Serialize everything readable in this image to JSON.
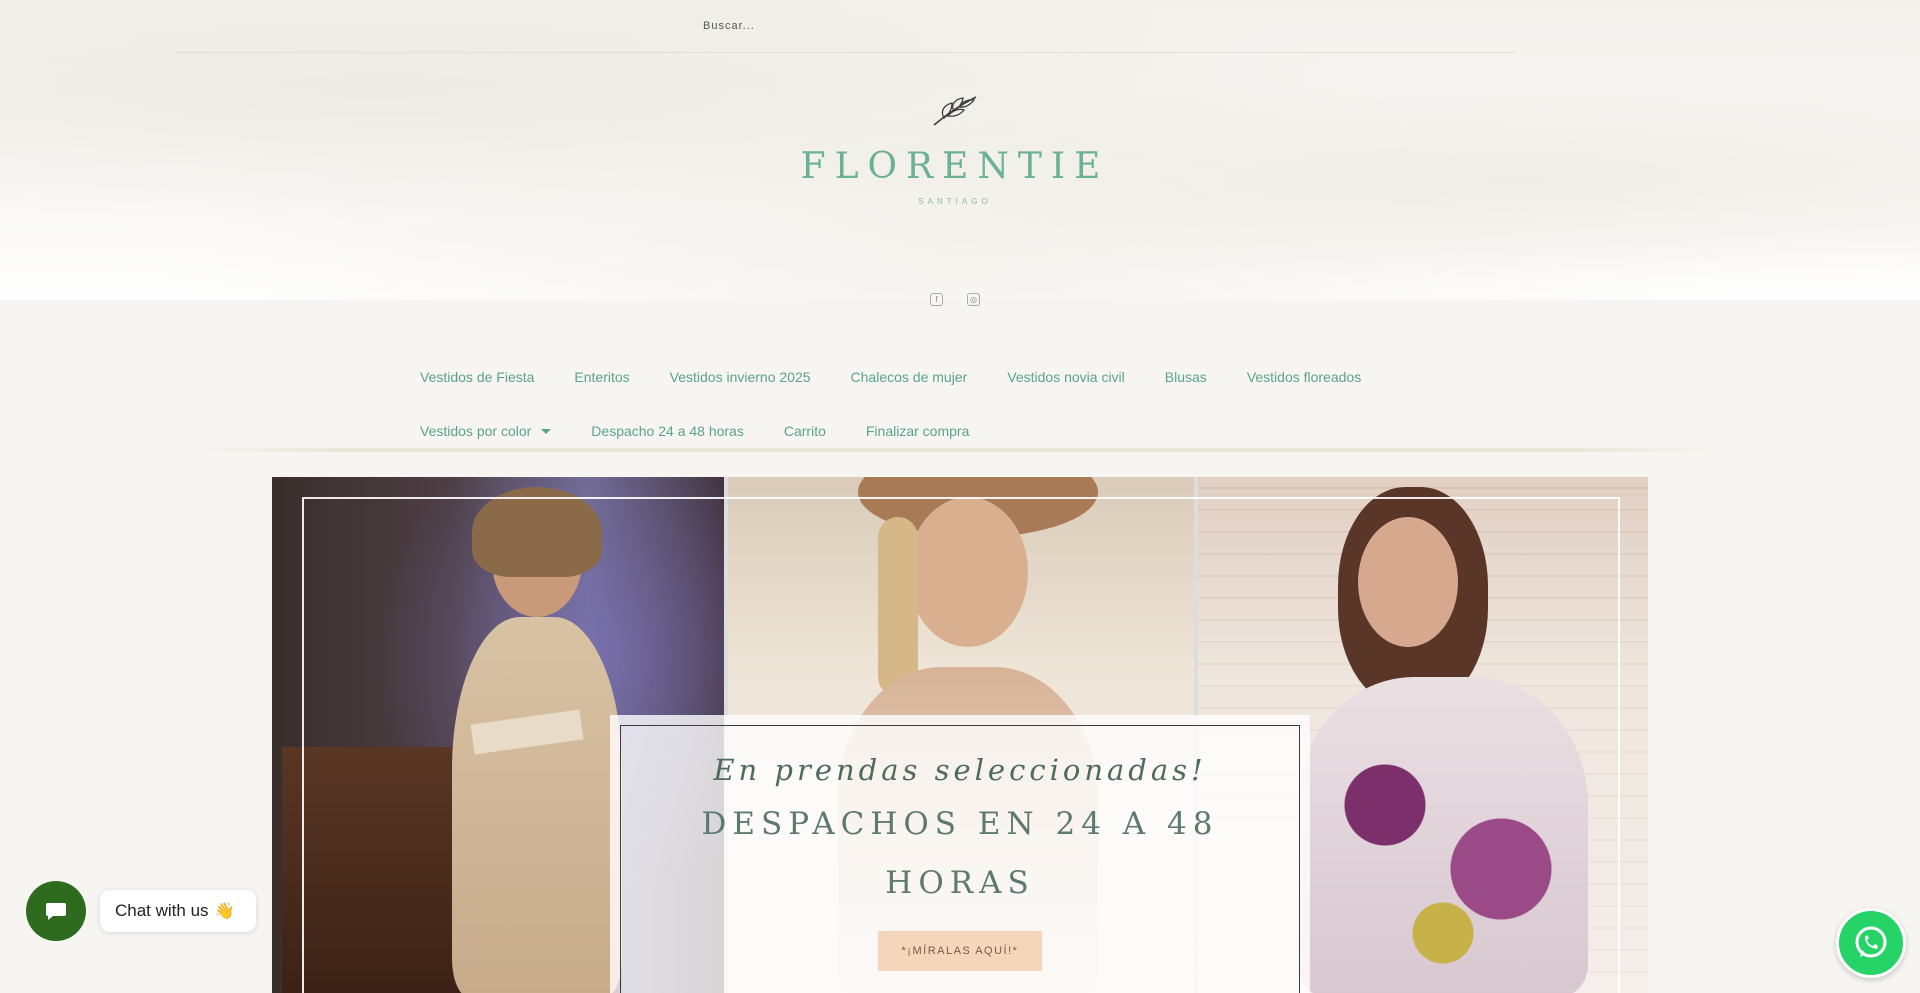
{
  "search": {
    "placeholder": "Buscar..."
  },
  "logo": {
    "name": "FLORENTIE",
    "subtitle": "SANTIAGO"
  },
  "social": {
    "facebook_icon": "facebook-icon",
    "instagram_icon": "instagram-icon"
  },
  "nav": {
    "row1": [
      {
        "label": "Vestidos de Fiesta"
      },
      {
        "label": "Enteritos"
      },
      {
        "label": "Vestidos invierno 2025"
      },
      {
        "label": "Chalecos de mujer"
      },
      {
        "label": "Vestidos novia civil"
      },
      {
        "label": "Blusas"
      },
      {
        "label": "Vestidos floreados"
      }
    ],
    "row2": [
      {
        "label": "Vestidos por color",
        "dropdown": true
      },
      {
        "label": "Despacho 24 a 48 horas"
      },
      {
        "label": "Carrito"
      },
      {
        "label": "Finalizar compra"
      }
    ]
  },
  "hero": {
    "promo_italic": "En prendas seleccionadas!",
    "promo_heading": "DESPACHOS EN 24 A 48 HORAS",
    "cta_label": "*¡MÍRALAS AQUÍ!*"
  },
  "chat": {
    "label": "Chat with us",
    "emoji": "👋"
  },
  "colors": {
    "accent": "#5aa38b",
    "cta": "#f6d6bb",
    "chat": "#2f6b1e",
    "whatsapp": "#25d366"
  }
}
